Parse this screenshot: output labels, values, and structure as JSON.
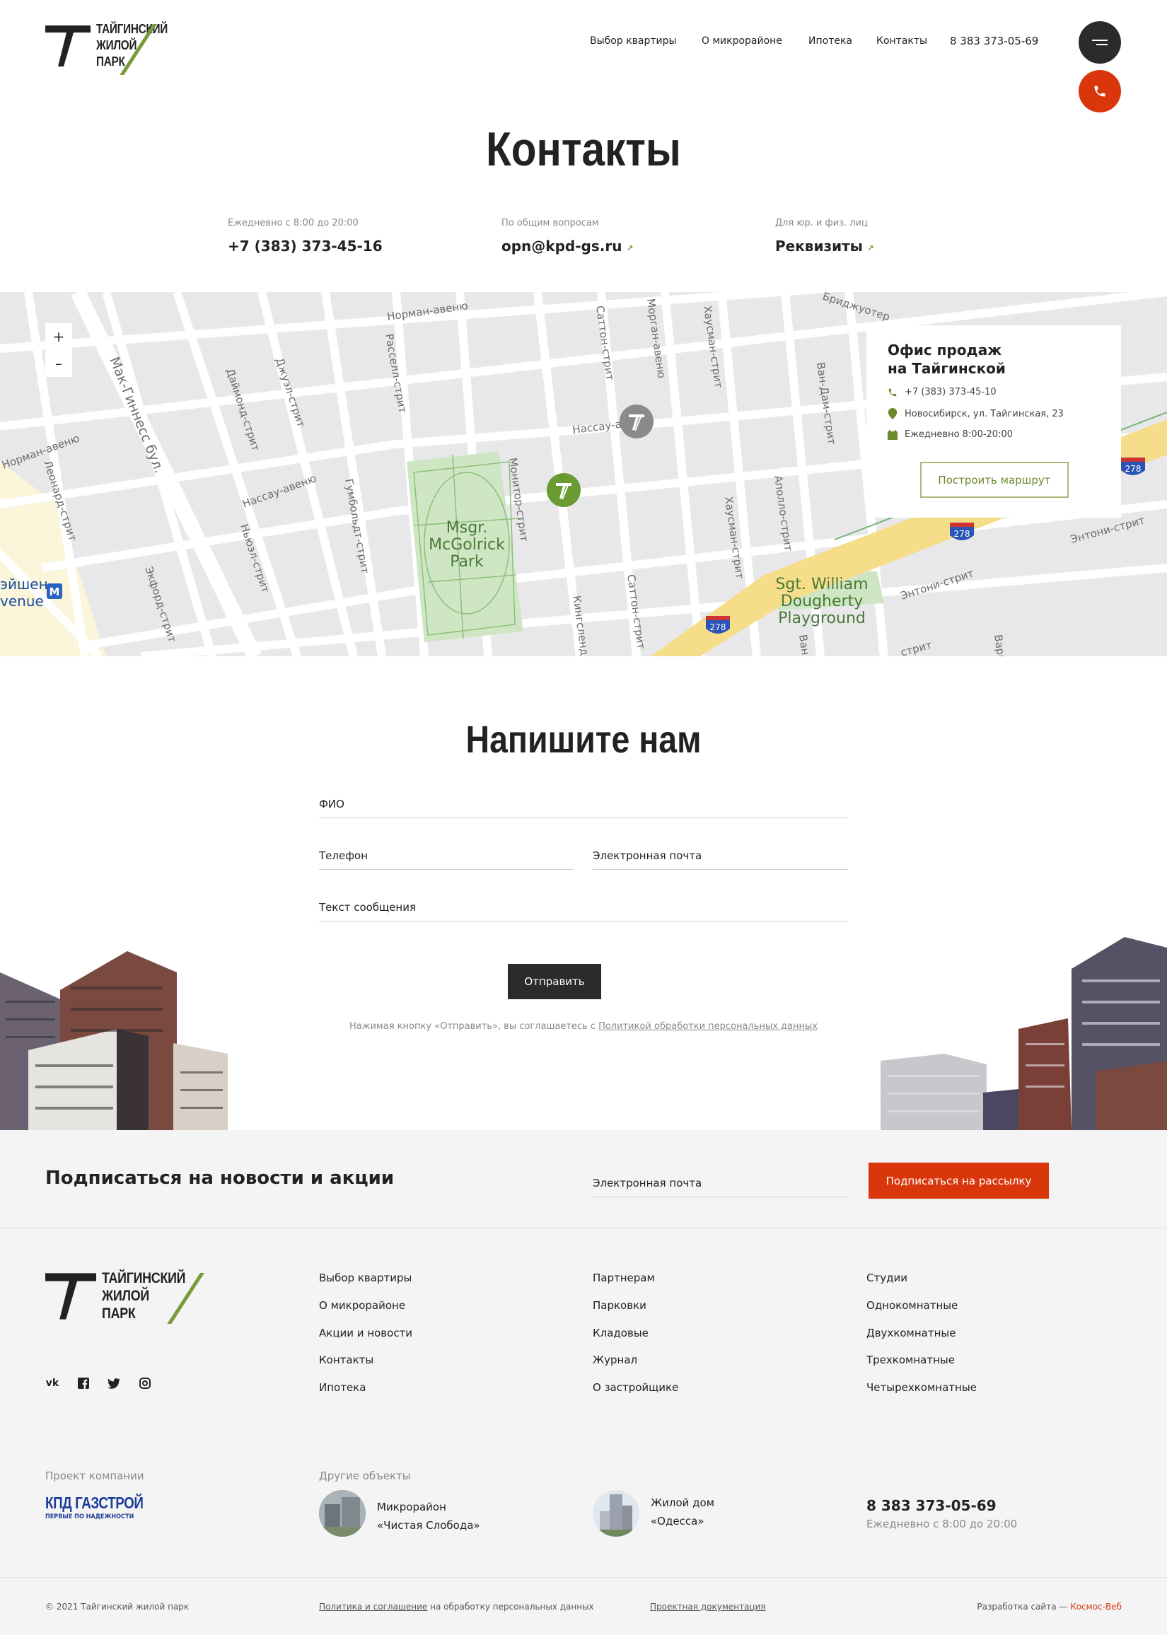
{
  "header": {
    "logo_lines": [
      "ТАЙГИНСКИЙ",
      "ЖИЛОЙ",
      "ПАРК"
    ],
    "nav": [
      "Выбор квартиры",
      "О микрорайоне",
      "Ипотека",
      "Контакты",
      "8 383 373-05-69"
    ]
  },
  "page": {
    "title": "Контакты",
    "contacts": [
      {
        "caption": "Ежедневно с 8:00 до 20:00",
        "value": "+7 (383) 373-45-16"
      },
      {
        "caption": "По общим вопросам",
        "value": "opn@kpd-gs.ru"
      },
      {
        "caption": "Для юр. и физ. лиц",
        "value": "Реквизиты"
      }
    ]
  },
  "map": {
    "zoom_in": "+",
    "zoom_out": "–",
    "streets": [
      "Норман-авеню",
      "Расселл-стрит",
      "Саттон-стрит",
      "Морган-авеню",
      "Хаусман-стрит",
      "Бриджуотер",
      "Ван-Дам-стрит",
      "Мак-Гиннесс бул.",
      "Даймонд-стрит",
      "Джуэл-стрит",
      "Нассау-авеню",
      "Нассау-а",
      "Гумбольдт-стрит",
      "Ньюэл-стрит",
      "Монитор-стрит",
      "Кингсленд",
      "Саттон-стрит",
      "Хаусман-стрит",
      "Аполло-стрит",
      "Энтони-стрит",
      "Энтони-стрит",
      "Норман-авеню",
      "Леонард-стрит",
      "Экфорд-стрит",
      "Варик",
      "стрит",
      "Ван"
    ],
    "park": [
      "Msgr.",
      "McGolrick",
      "Park"
    ],
    "playground": [
      "Sgt. William",
      "Dougherty",
      "Playground"
    ],
    "route_badges": [
      "278",
      "278",
      "278"
    ],
    "metro_text": [
      "эйшен",
      "venue"
    ],
    "metro_badge": "M",
    "office": {
      "title_lines": [
        "Офис продаж",
        "на Тайгинской"
      ],
      "phone": "+7 (383) 373-45-10",
      "address": "Новосибирск, ул. Тайгинская, 23",
      "hours": "Ежедневно 8:00-20:00",
      "route_button": "Построить маршрут"
    }
  },
  "form": {
    "title": "Напишите нам",
    "name_label": "ФИО",
    "phone_label": "Телефон",
    "email_label": "Электронная почта",
    "message_label": "Текст сообщения",
    "submit": "Отправить",
    "consent_text": "Нажимая кнопку «Отправить», вы соглашаетесь с ",
    "consent_link": "Политикой обработки персональных данных"
  },
  "subscribe": {
    "title": "Подписаться на новости и акции",
    "email_label": "Электронная почта",
    "button": "Подписаться на рассылку"
  },
  "footer": {
    "logo_lines": [
      "ТАЙГИНСКИЙ",
      "ЖИЛОЙ",
      "ПАРК"
    ],
    "col1": [
      "Выбор квартиры",
      "О микрорайоне",
      "Акции и новости",
      "Контакты",
      "Ипотека"
    ],
    "col2": [
      "Партнерам",
      "Парковки",
      "Кладовые",
      "Журнал",
      "О застройщике"
    ],
    "col3": [
      "Студии",
      "Однокомнатные",
      "Двухкомнатные",
      "Трехкомнатные",
      "Четырехкомнатные"
    ],
    "project_caption": "Проект компании",
    "company_name": "КПД ГАЗСТРОЙ",
    "company_slogan": "ПЕРВЫЕ ПО НАДЕЖНОСТИ",
    "other_caption": "Другие объекты",
    "object1": [
      "Микрорайон",
      "«Чистая Слобода»"
    ],
    "object2": [
      "Жилой дом",
      "«Одесса»"
    ],
    "phone": "8 383 373-05-69",
    "hours": "Ежедневно с 8:00 до 20:00",
    "copyright": "© 2021  Тайгинский жилой парк",
    "policy_link": "Политика и соглашение",
    "policy_rest": " на обработку персональных данных",
    "docs_link": "Проектная документация",
    "dev_text": "Разработка сайта — ",
    "dev_link": "Космос-Веб"
  },
  "colors": {
    "accent_green": "#7a9a3a",
    "accent_red": "#d9360b",
    "dark": "#2b2b2b"
  }
}
